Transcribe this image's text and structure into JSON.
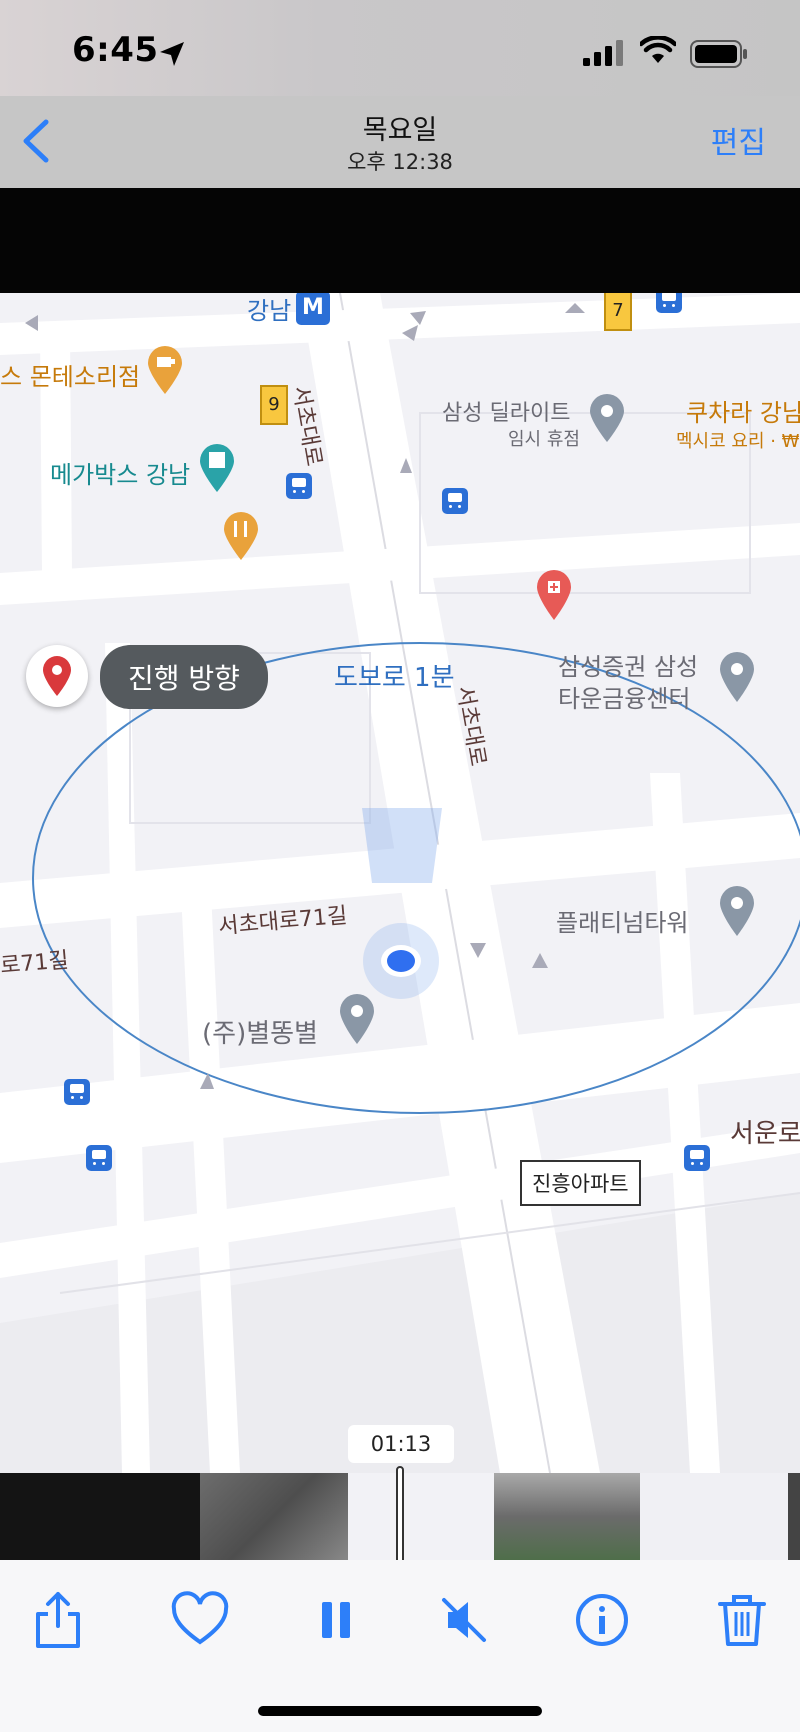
{
  "status": {
    "time": "6:45"
  },
  "nav": {
    "title": "목요일",
    "subtitle": "오후 12:38",
    "edit_label": "편집"
  },
  "map": {
    "labels": {
      "gangnam_station": "강남",
      "montessori": "스 몬테소리점",
      "megabox": "메가박스 강남",
      "seocho_daero_top": "서초대로",
      "seocho_daero_mid": "서초대로",
      "samsung_delight": "삼성 딜라이트",
      "temp_closed": "임시 휴점",
      "kuchara": "쿠차라 강남",
      "mexican": "멕시코 요리 · ₩",
      "walk_time": "도보로 1분",
      "heading_bubble": "진행 방향",
      "samsung_securities_1": "삼성증권 삼성",
      "samsung_securities_2": "타운금융센터",
      "platinum_tower": "플래티넘타워",
      "seocho_71gil": "서초대로71길",
      "seocho_71gil_left": "로71길",
      "byeoldong": "(주)별똥별",
      "seoun_ro": "서운로",
      "jinheung_apt": "진흥아파트"
    },
    "route_badges": [
      "7",
      "9"
    ],
    "metro_badge": "M"
  },
  "player": {
    "timecode": "01:13"
  },
  "toolbar": {
    "icons": [
      "share-icon",
      "heart-icon",
      "pause-icon",
      "mute-icon",
      "info-icon",
      "trash-icon"
    ]
  },
  "colors": {
    "accent": "#2d7ff9",
    "map_bg": "#f4f4f7",
    "road": "#ffffff"
  }
}
